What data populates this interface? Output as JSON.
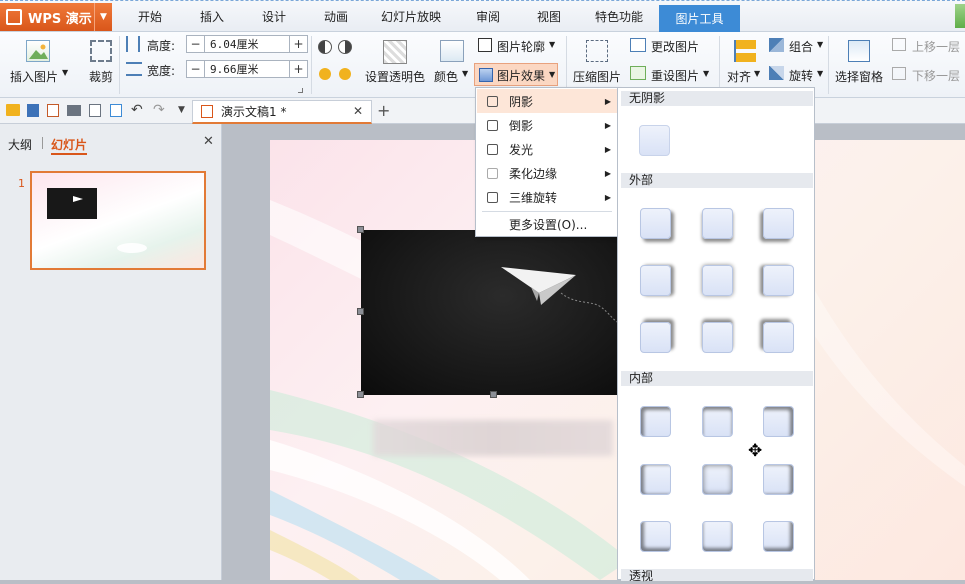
{
  "app": {
    "brand": "WPS 演示"
  },
  "tabs": [
    "开始",
    "插入",
    "设计",
    "动画",
    "幻灯片放映",
    "审阅",
    "视图",
    "特色功能"
  ],
  "active_tab": "图片工具",
  "ribbon": {
    "insert_picture": "插入图片",
    "crop": "裁剪",
    "height_label": "高度:",
    "height_value": "6.04厘米",
    "width_label": "宽度:",
    "width_value": "9.66厘米",
    "set_transparent": "设置透明色",
    "color": "颜色",
    "outline": "图片轮廓",
    "effects": "图片效果",
    "compress": "压缩图片",
    "change_picture": "更改图片",
    "reset_picture": "重设图片",
    "align": "对齐",
    "group": "组合",
    "rotate": "旋转",
    "selection_pane": "选择窗格",
    "bring_forward": "上移一层",
    "send_backward": "下移一层"
  },
  "document": {
    "tab_title": "演示文稿1 *"
  },
  "left_pane": {
    "outline_tab": "大纲",
    "slides_tab": "幻灯片",
    "slide_number": "1"
  },
  "effects_menu": {
    "items": [
      "阴影",
      "倒影",
      "发光",
      "柔化边缘",
      "三维旋转"
    ],
    "more": "更多设置(O)..."
  },
  "shadow_gallery": {
    "no_shadow": "无阴影",
    "outer": "外部",
    "inner": "内部",
    "perspective": "透视"
  },
  "colors": {
    "accent": "#3d8bd6",
    "brand": "#e0601f",
    "hover": "#fde6d8"
  }
}
